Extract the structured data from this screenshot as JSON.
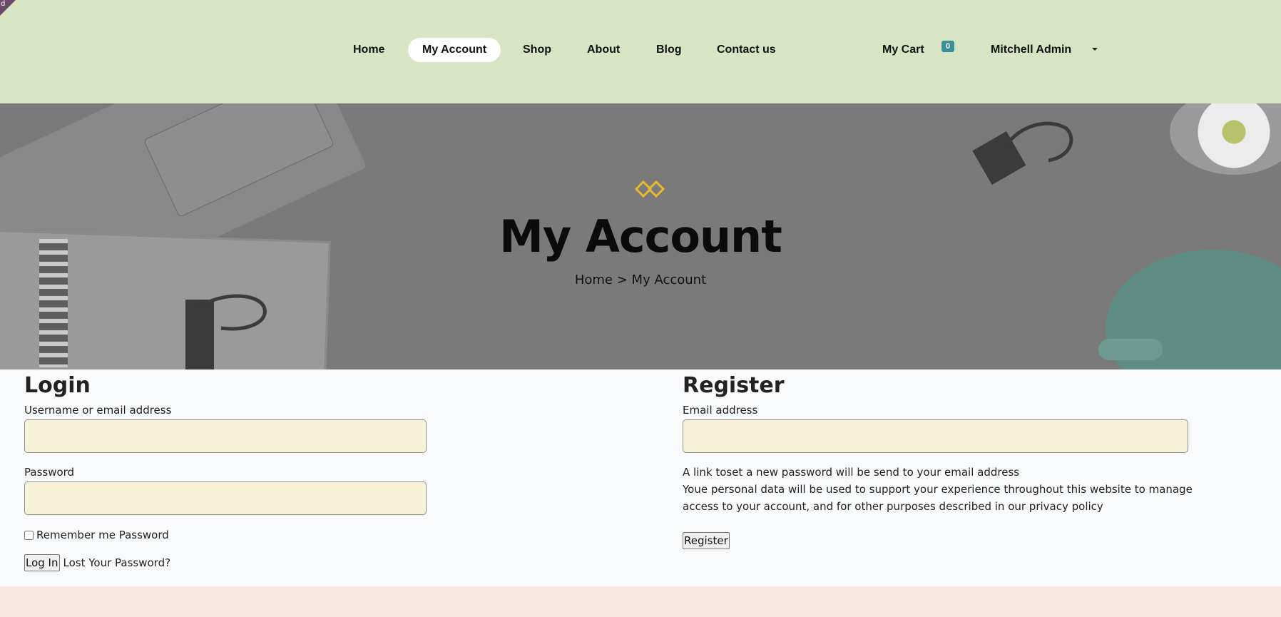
{
  "corner_badge": "d",
  "header": {
    "nav": [
      {
        "label": "Home",
        "active": false
      },
      {
        "label": "My Account",
        "active": true
      },
      {
        "label": "Shop",
        "active": false
      },
      {
        "label": "About",
        "active": false
      },
      {
        "label": "Blog",
        "active": false
      },
      {
        "label": "Contact us",
        "active": false
      }
    ],
    "cart_label": "My Cart",
    "cart_count": "0",
    "user_name": "Mitchell Admin"
  },
  "hero": {
    "title": "My Account",
    "breadcrumb_home": "Home >",
    "breadcrumb_current": "My Account",
    "icon": "diamond-logo-icon"
  },
  "login": {
    "heading": "Login",
    "username_label": "Username or email address",
    "username_value": "",
    "password_label": "Password",
    "password_value": "",
    "remember_label": "Remember me Password",
    "remember_checked": false,
    "submit_label": "Log In",
    "lost_password_label": "Lost Your Password?"
  },
  "register": {
    "heading": "Register",
    "email_label": "Email address",
    "email_value": "",
    "info_line1": "A link toset a new password will be send to your email address",
    "info_line2": "Youe personal data will be used to support your experience throughout this website to manage access to your account, and for other purposes described in our privacy policy",
    "submit_label": "Register"
  },
  "colors": {
    "header_bg": "#d8e5c4",
    "hero_bg": "#7a7a7a",
    "input_bg": "#f7f1d8",
    "badge_bg": "#3a8f98",
    "logo_accent": "#e8b92e",
    "footer_bg": "#f9e6df"
  }
}
